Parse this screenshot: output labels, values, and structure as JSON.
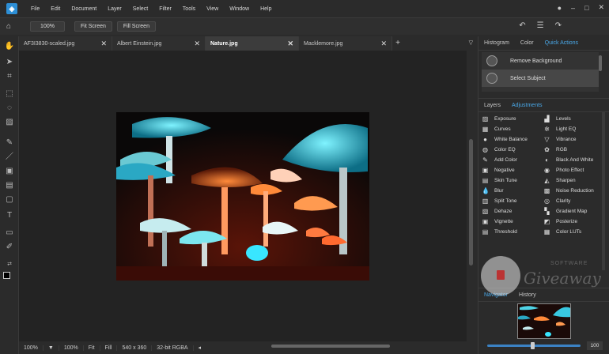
{
  "menubar": {
    "items": [
      "File",
      "Edit",
      "Document",
      "Layer",
      "Select",
      "Filter",
      "Tools",
      "View",
      "Window",
      "Help"
    ]
  },
  "toolbar": {
    "zoom": "100%",
    "fit_screen": "Fit Screen",
    "fill_screen": "Fill Screen"
  },
  "tabs": [
    {
      "label": "AF3I3830-scaled.jpg"
    },
    {
      "label": "Albert Einstein.jpg"
    },
    {
      "label": "Nature.jpg"
    },
    {
      "label": "Macklemore.jpg"
    }
  ],
  "right_panel": {
    "top_tabs": [
      "Histogram",
      "Color",
      "Quick Actions"
    ],
    "quick_actions": [
      "Remove Background",
      "Select Subject"
    ],
    "mid_tabs": [
      "Layers",
      "Adjustments"
    ],
    "adjustments_left": [
      "Exposure",
      "Curves",
      "White Balance",
      "Color EQ",
      "Add Color",
      "Negative",
      "Skin Tune",
      "Blur",
      "Split Tone",
      "Dehaze",
      "Vignette",
      "Threshold"
    ],
    "adjustments_right": [
      "Levels",
      "Light EQ",
      "Vibrance",
      "RGB",
      "Black And White",
      "Photo Effect",
      "Sharpen",
      "Noise Reduction",
      "Clarity",
      "Gradient Map",
      "Posterize",
      "Color LUTs"
    ],
    "bottom_tabs": [
      "Navigator",
      "History"
    ],
    "nav_zoom": "100"
  },
  "status": {
    "zoom": "100%",
    "zoom2": "100%",
    "fit": "Fit",
    "fill": "Fill",
    "size": "540 x 360",
    "mode": "32-bit RGBA"
  },
  "watermark": {
    "small": "SOFTWARE",
    "big": "Giveaway"
  },
  "colors": {
    "accent": "#4aa8e8",
    "bg": "#2b2b2b",
    "canvas": "#232323"
  }
}
